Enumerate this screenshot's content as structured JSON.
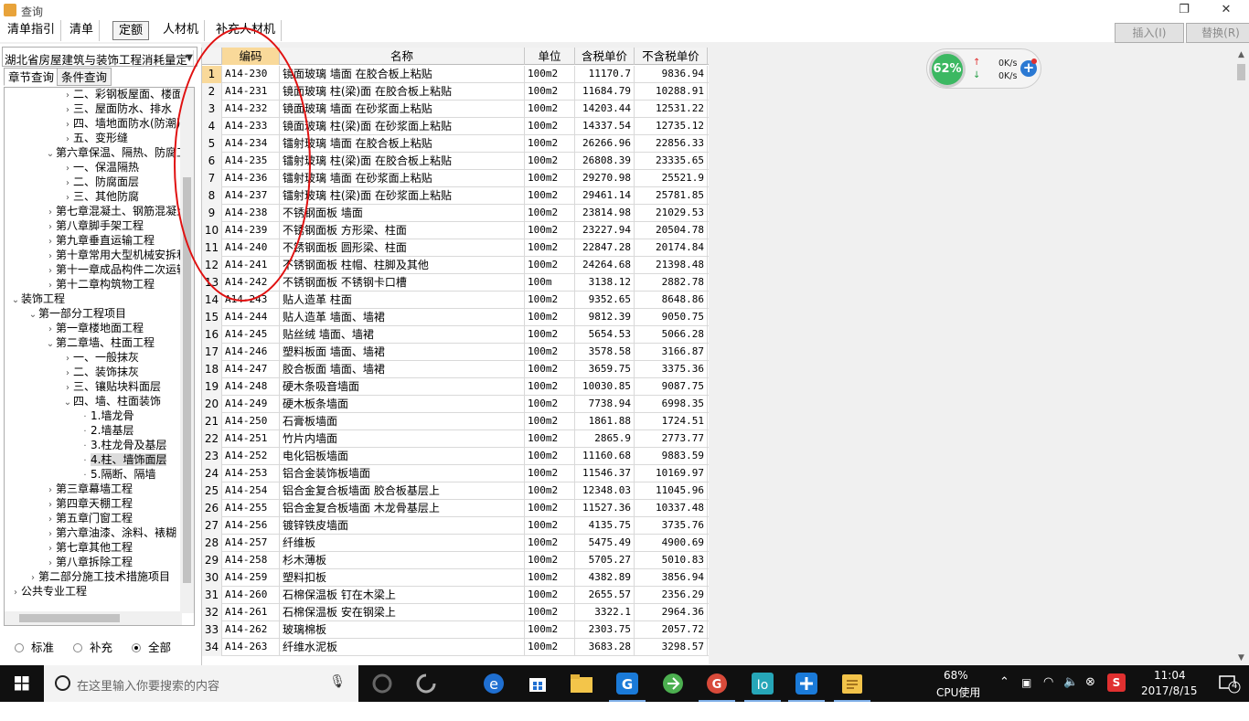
{
  "window": {
    "title": "查询",
    "restore_glyph": "❐",
    "close_glyph": "✕"
  },
  "tabs": [
    "清单指引",
    "清单",
    "定额",
    "人材机",
    "补充人材机"
  ],
  "active_tab": 2,
  "actions": {
    "insert": "插入(I)",
    "replace": "替换(R)"
  },
  "left": {
    "select_value": "湖北省房屋建筑与装饰工程消耗量定",
    "subtabs": [
      "章节查询",
      "条件查询"
    ],
    "tree": [
      {
        "label": "二、彩钢板屋面、楼面",
        "indent": 3,
        "state": "collapsed"
      },
      {
        "label": "三、屋面防水、排水",
        "indent": 3,
        "state": "collapsed"
      },
      {
        "label": "四、墙地面防水(防潮)",
        "indent": 3,
        "state": "collapsed"
      },
      {
        "label": "五、变形缝",
        "indent": 3,
        "state": "collapsed"
      },
      {
        "label": "第六章保温、隔热、防腐工",
        "indent": 2,
        "state": "expanded"
      },
      {
        "label": "一、保温隔热",
        "indent": 3,
        "state": "collapsed"
      },
      {
        "label": "二、防腐面层",
        "indent": 3,
        "state": "collapsed"
      },
      {
        "label": "三、其他防腐",
        "indent": 3,
        "state": "collapsed"
      },
      {
        "label": "第七章混凝土、钢筋混凝土",
        "indent": 2,
        "state": "collapsed"
      },
      {
        "label": "第八章脚手架工程",
        "indent": 2,
        "state": "collapsed"
      },
      {
        "label": "第九章垂直运输工程",
        "indent": 2,
        "state": "collapsed"
      },
      {
        "label": "第十章常用大型机械安拆和",
        "indent": 2,
        "state": "collapsed"
      },
      {
        "label": "第十一章成品构件二次运输",
        "indent": 2,
        "state": "collapsed"
      },
      {
        "label": "第十二章构筑物工程",
        "indent": 2,
        "state": "collapsed"
      },
      {
        "label": "装饰工程",
        "indent": 0,
        "state": "expanded"
      },
      {
        "label": "第一部分工程项目",
        "indent": 1,
        "state": "expanded"
      },
      {
        "label": "第一章楼地面工程",
        "indent": 2,
        "state": "collapsed"
      },
      {
        "label": "第二章墙、柱面工程",
        "indent": 2,
        "state": "expanded"
      },
      {
        "label": "一、一般抹灰",
        "indent": 3,
        "state": "collapsed"
      },
      {
        "label": "二、装饰抹灰",
        "indent": 3,
        "state": "collapsed"
      },
      {
        "label": "三、镶贴块料面层",
        "indent": 3,
        "state": "collapsed"
      },
      {
        "label": "四、墙、柱面装饰",
        "indent": 3,
        "state": "expanded"
      },
      {
        "label": "1.墙龙骨",
        "indent": 4,
        "state": "leaf"
      },
      {
        "label": "2.墙基层",
        "indent": 4,
        "state": "leaf"
      },
      {
        "label": "3.柱龙骨及基层",
        "indent": 4,
        "state": "leaf"
      },
      {
        "label": "4.柱、墙饰面层",
        "indent": 4,
        "state": "leaf",
        "selected": true
      },
      {
        "label": "5.隔断、隔墙",
        "indent": 4,
        "state": "leaf"
      },
      {
        "label": "第三章幕墙工程",
        "indent": 2,
        "state": "collapsed"
      },
      {
        "label": "第四章天棚工程",
        "indent": 2,
        "state": "collapsed"
      },
      {
        "label": "第五章门窗工程",
        "indent": 2,
        "state": "collapsed"
      },
      {
        "label": "第六章油漆、涂料、裱糊",
        "indent": 2,
        "state": "collapsed"
      },
      {
        "label": "第七章其他工程",
        "indent": 2,
        "state": "collapsed"
      },
      {
        "label": "第八章拆除工程",
        "indent": 2,
        "state": "collapsed"
      },
      {
        "label": "第二部分施工技术措施项目",
        "indent": 1,
        "state": "collapsed"
      },
      {
        "label": "公共专业工程",
        "indent": 0,
        "state": "collapsed"
      }
    ],
    "radios": [
      {
        "label": "标准",
        "checked": false
      },
      {
        "label": "补充",
        "checked": false
      },
      {
        "label": "全部",
        "checked": true
      }
    ]
  },
  "grid": {
    "headers": {
      "code": "编码",
      "name": "名称",
      "unit": "单位",
      "price_tax": "含税单价",
      "price_notax": "不含税单价"
    },
    "rows": [
      [
        "1",
        "A14-230",
        "镜面玻璃 墙面 在胶合板上粘贴",
        "100m2",
        "11170.7",
        "9836.94"
      ],
      [
        "2",
        "A14-231",
        "镜面玻璃 柱(梁)面 在胶合板上粘贴",
        "100m2",
        "11684.79",
        "10288.91"
      ],
      [
        "3",
        "A14-232",
        "镜面玻璃 墙面 在砂浆面上粘贴",
        "100m2",
        "14203.44",
        "12531.22"
      ],
      [
        "4",
        "A14-233",
        "镜面玻璃 柱(梁)面 在砂浆面上粘贴",
        "100m2",
        "14337.54",
        "12735.12"
      ],
      [
        "5",
        "A14-234",
        "镭射玻璃 墙面 在胶合板上粘贴",
        "100m2",
        "26266.96",
        "22856.33"
      ],
      [
        "6",
        "A14-235",
        "镭射玻璃 柱(梁)面 在胶合板上粘贴",
        "100m2",
        "26808.39",
        "23335.65"
      ],
      [
        "7",
        "A14-236",
        "镭射玻璃 墙面 在砂浆面上粘贴",
        "100m2",
        "29270.98",
        "25521.9"
      ],
      [
        "8",
        "A14-237",
        "镭射玻璃 柱(梁)面 在砂浆面上粘贴",
        "100m2",
        "29461.14",
        "25781.85"
      ],
      [
        "9",
        "A14-238",
        "不锈钢面板 墙面",
        "100m2",
        "23814.98",
        "21029.53"
      ],
      [
        "10",
        "A14-239",
        "不锈钢面板 方形梁、柱面",
        "100m2",
        "23227.94",
        "20504.78"
      ],
      [
        "11",
        "A14-240",
        "不锈钢面板 圆形梁、柱面",
        "100m2",
        "22847.28",
        "20174.84"
      ],
      [
        "12",
        "A14-241",
        "不锈钢面板 柱帽、柱脚及其他",
        "100m2",
        "24264.68",
        "21398.48"
      ],
      [
        "13",
        "A14-242",
        "不锈钢面板 不锈钢卡口槽",
        "100m",
        "3138.12",
        "2882.78"
      ],
      [
        "14",
        "A14-243",
        "贴人造革 柱面",
        "100m2",
        "9352.65",
        "8648.86"
      ],
      [
        "15",
        "A14-244",
        "贴人造革 墙面、墙裙",
        "100m2",
        "9812.39",
        "9050.75"
      ],
      [
        "16",
        "A14-245",
        "贴丝绒 墙面、墙裙",
        "100m2",
        "5654.53",
        "5066.28"
      ],
      [
        "17",
        "A14-246",
        "塑料板面 墙面、墙裙",
        "100m2",
        "3578.58",
        "3166.87"
      ],
      [
        "18",
        "A14-247",
        "胶合板面 墙面、墙裙",
        "100m2",
        "3659.75",
        "3375.36"
      ],
      [
        "19",
        "A14-248",
        "硬木条吸音墙面",
        "100m2",
        "10030.85",
        "9087.75"
      ],
      [
        "20",
        "A14-249",
        "硬木板条墙面",
        "100m2",
        "7738.94",
        "6998.35"
      ],
      [
        "21",
        "A14-250",
        "石膏板墙面",
        "100m2",
        "1861.88",
        "1724.51"
      ],
      [
        "22",
        "A14-251",
        "竹片内墙面",
        "100m2",
        "2865.9",
        "2773.77"
      ],
      [
        "23",
        "A14-252",
        "电化铝板墙面",
        "100m2",
        "11160.68",
        "9883.59"
      ],
      [
        "24",
        "A14-253",
        "铝合金装饰板墙面",
        "100m2",
        "11546.37",
        "10169.97"
      ],
      [
        "25",
        "A14-254",
        "铝合金复合板墙面 胶合板基层上",
        "100m2",
        "12348.03",
        "11045.96"
      ],
      [
        "26",
        "A14-255",
        "铝合金复合板墙面 木龙骨基层上",
        "100m2",
        "11527.36",
        "10337.48"
      ],
      [
        "27",
        "A14-256",
        "镀锌铁皮墙面",
        "100m2",
        "4135.75",
        "3735.76"
      ],
      [
        "28",
        "A14-257",
        "纤维板",
        "100m2",
        "5475.49",
        "4900.69"
      ],
      [
        "29",
        "A14-258",
        "杉木薄板",
        "100m2",
        "5705.27",
        "5010.83"
      ],
      [
        "30",
        "A14-259",
        "塑料扣板",
        "100m2",
        "4382.89",
        "3856.94"
      ],
      [
        "31",
        "A14-260",
        "石棉保温板 钉在木梁上",
        "100m2",
        "2655.57",
        "2356.29"
      ],
      [
        "32",
        "A14-261",
        "石棉保温板 安在钢梁上",
        "100m2",
        "3322.1",
        "2964.36"
      ],
      [
        "33",
        "A14-262",
        "玻璃棉板",
        "100m2",
        "2303.75",
        "2057.72"
      ],
      [
        "34",
        "A14-263",
        "纤维水泥板",
        "100m2",
        "3683.28",
        "3298.57"
      ]
    ]
  },
  "widget": {
    "percent": "62%",
    "up_speed": "0K/s",
    "down_speed": "0K/s"
  },
  "taskbar": {
    "search_placeholder": "在这里输入你要搜索的内容",
    "cpu_percent": "68%",
    "cpu_label": "CPU使用",
    "time": "11:04",
    "date": "2017/8/15",
    "notification_count": "4",
    "colors": {
      "edge": "#1f6fd1",
      "accent": "#7fb0e8"
    }
  }
}
